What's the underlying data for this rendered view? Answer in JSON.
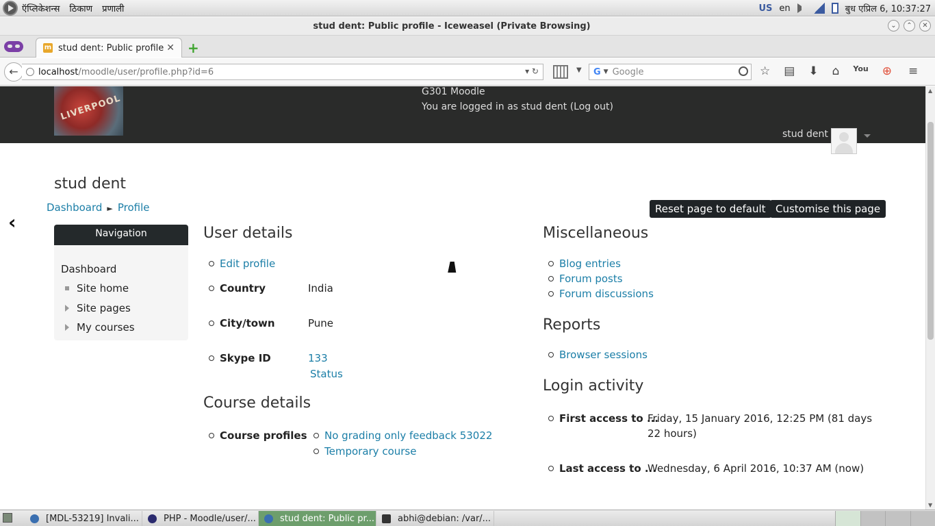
{
  "system_panel": {
    "menu": [
      "ऍप्लिकेशन्स",
      "ठिकाण",
      "प्रणाली"
    ],
    "keyboard_layout": "US",
    "lang": "en",
    "clock": "बुध एप्रिल  6, 10:37:27"
  },
  "window": {
    "title": "stud dent: Public profile - Iceweasel (Private Browsing)"
  },
  "browser": {
    "tab_label": "stud dent: Public profile",
    "url_host": "localhost",
    "url_path": "/moodle/user/profile.php?id=6",
    "search_placeholder": "Google"
  },
  "site": {
    "name": "G301 Moodle",
    "logged_in_prefix": "You are logged in as ",
    "logged_in_user": "stud dent",
    "logout_label": "(Log out)",
    "user_menu_name": "stud dent",
    "logo_text": "LIVERPOOL"
  },
  "page": {
    "heading": "stud dent",
    "breadcrumb": [
      "Dashboard",
      "Profile"
    ],
    "breadcrumb_sep": "►",
    "reset_button": "Reset page to default",
    "customise_button": "Customise this page"
  },
  "navigation": {
    "title": "Navigation",
    "dashboard": "Dashboard",
    "items": [
      "Site home",
      "Site pages",
      "My courses"
    ]
  },
  "user_details": {
    "title": "User details",
    "edit_profile": "Edit profile",
    "country_label": "Country",
    "country_value": "India",
    "city_label": "City/town",
    "city_value": "Pune",
    "skype_label": "Skype ID",
    "skype_value": "133",
    "skype_status": "Status"
  },
  "course_details": {
    "title": "Course details",
    "label": "Course profiles",
    "courses": [
      "No grading only feedback 53022",
      "Temporary course"
    ]
  },
  "misc": {
    "title": "Miscellaneous",
    "links": [
      "Blog entries",
      "Forum posts",
      "Forum discussions"
    ]
  },
  "reports": {
    "title": "Reports",
    "links": [
      "Browser sessions"
    ]
  },
  "login_activity": {
    "title": "Login activity",
    "first_label": "First access to ...",
    "first_value_line1": "Friday, 15 January 2016, 12:25 PM  (81 days",
    "first_value_line2": "22 hours)",
    "last_label": "Last access to ...",
    "last_value": "Wednesday, 6 April 2016, 10:37 AM  (now)"
  },
  "taskbar": {
    "tasks": [
      "[MDL-53219] Invali...",
      "PHP - Moodle/user/...",
      "stud dent: Public pr...",
      "abhi@debian: /var/..."
    ]
  }
}
